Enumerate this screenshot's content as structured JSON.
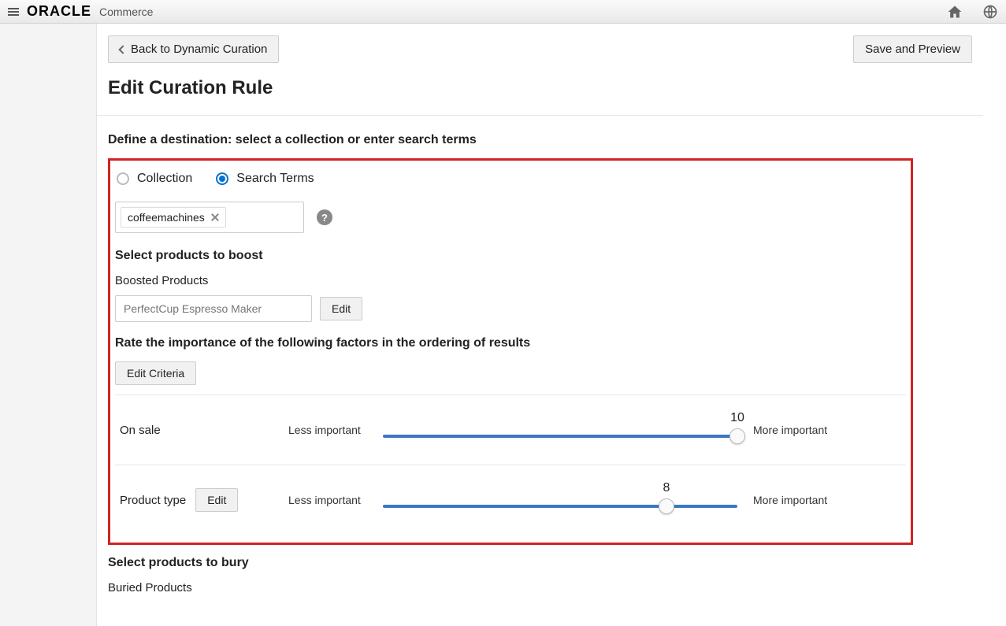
{
  "brand": "ORACLE",
  "brand_sub": "Commerce",
  "back_button": "Back to Dynamic Curation",
  "save_button": "Save and Preview",
  "page_title": "Edit Curation Rule",
  "destination": {
    "label": "Define a destination: select a collection or enter search terms",
    "options": {
      "collection": "Collection",
      "search_terms": "Search Terms"
    },
    "selected": "search_terms",
    "search_terms": [
      "coffeemachines"
    ]
  },
  "boost": {
    "section": "Select products to boost",
    "sub": "Boosted Products",
    "placeholder": "PerfectCup Espresso Maker",
    "edit": "Edit"
  },
  "rating": {
    "section": "Rate the importance of the following factors in the ordering of results",
    "edit_criteria": "Edit Criteria",
    "less": "Less important",
    "more": "More important",
    "max": 10,
    "factors": [
      {
        "name": "On sale",
        "value": 10,
        "editable": false
      },
      {
        "name": "Product type",
        "value": 8,
        "editable": true
      }
    ],
    "edit": "Edit"
  },
  "bury": {
    "section": "Select products to bury",
    "sub": "Buried Products"
  }
}
